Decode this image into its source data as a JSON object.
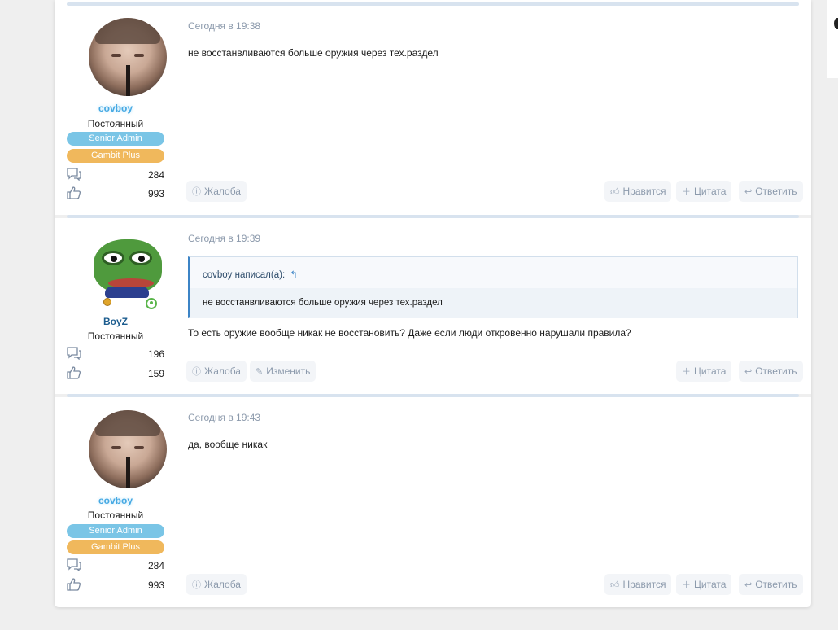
{
  "posts": [
    {
      "user": {
        "name": "covboy",
        "title": "Постоянный",
        "banners": [
          "Senior Admin",
          "Gambit Plus"
        ],
        "messages": "284",
        "reactions": "993"
      },
      "date": "Сегодня в 19:38",
      "text": "не восстанвливаются больше оружия через тех.раздел",
      "actions": {
        "report": "Жалоба",
        "like": "Нравится",
        "quote": "Цитата",
        "reply": "Ответить"
      }
    },
    {
      "user": {
        "name": "BoyZ",
        "title": "Постоянный",
        "messages": "196",
        "reactions": "159"
      },
      "date": "Сегодня в 19:39",
      "quote": {
        "author": "covboy написал(а):",
        "text": "не восстанвливаются больше оружия через тех.раздел"
      },
      "text": "То есть оружие вообще никак не восстановить? Даже если люди откровенно нарушали правила?",
      "actions": {
        "report": "Жалоба",
        "edit": "Изменить",
        "quote": "Цитата",
        "reply": "Ответить"
      }
    },
    {
      "user": {
        "name": "covboy",
        "title": "Постоянный",
        "banners": [
          "Senior Admin",
          "Gambit Plus"
        ],
        "messages": "284",
        "reactions": "993"
      },
      "date": "Сегодня в 19:43",
      "text": "да, вообще никак",
      "actions": {
        "report": "Жалоба",
        "like": "Нравится",
        "quote": "Цитата",
        "reply": "Ответить"
      }
    }
  ],
  "icons": {
    "messages": "comment-icon",
    "reactions": "thumbs-up-icon",
    "report": "alert-circle-icon",
    "like": "thumbs-up-icon",
    "quote": "plus-icon",
    "reply": "reply-icon",
    "edit": "pencil-icon",
    "jump": "arrow-up-icon"
  },
  "colors": {
    "admin_banner": "#7ac5e6",
    "gambit_banner": "#f0b85c",
    "username_glow": "#46a9e3",
    "username_plain": "#1d5d8f",
    "muted_text": "#8c9aac",
    "quote_border": "#3c84c6"
  }
}
